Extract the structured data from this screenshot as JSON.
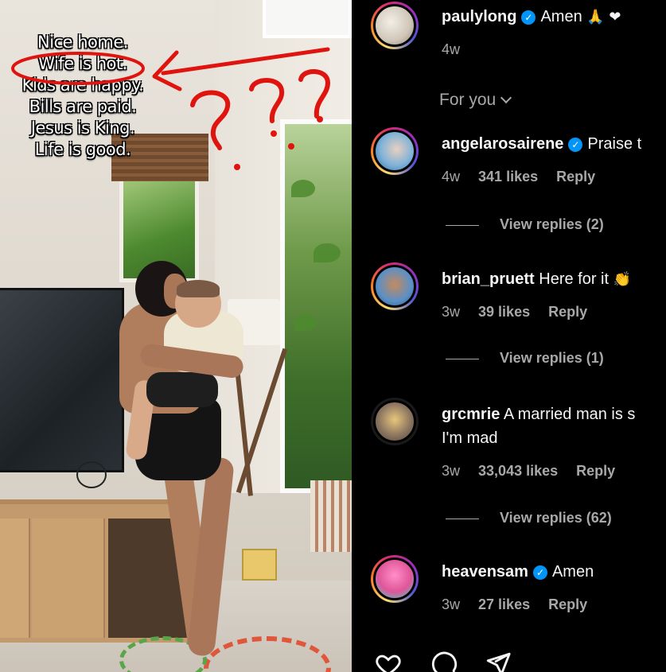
{
  "post_overlay": {
    "lines": [
      "Nice home.",
      "Wife is hot.",
      "Kids are happy.",
      "Bills are paid.",
      "Jesus is King.",
      "Life is good."
    ],
    "annotation_marks": "???",
    "colors": {
      "annotation": "#e0140e",
      "text": "#ffffff"
    }
  },
  "caption": {
    "username": "paulylong",
    "verified": true,
    "text": "Amen",
    "emojis": "🙏 ❤",
    "time": "4w"
  },
  "sort_label": "For you",
  "comments": [
    {
      "username": "angelarosairene",
      "verified": true,
      "text": "Praise t",
      "time": "4w",
      "likes": "341 likes",
      "reply": "Reply",
      "view_replies": "View replies (2)"
    },
    {
      "username": "brian_pruett",
      "verified": false,
      "text": "Here for it",
      "emoji": "👏",
      "time": "3w",
      "likes": "39 likes",
      "reply": "Reply",
      "view_replies": "View replies (1)"
    },
    {
      "username": "grcmrie",
      "verified": false,
      "text": "A married man is s",
      "text_line2": "I'm mad",
      "time": "3w",
      "likes": "33,043 likes",
      "reply": "Reply",
      "view_replies": "View replies (62)"
    },
    {
      "username": "heavensam",
      "verified": true,
      "text": "Amen",
      "time": "3w",
      "likes": "27 likes",
      "reply": "Reply"
    }
  ],
  "actions": [
    "heart-icon",
    "comment-icon",
    "share-icon"
  ],
  "theme": {
    "background": "#000000",
    "text": "#f5f5f5",
    "muted": "#a8a8a8",
    "verified": "#0095f6"
  }
}
